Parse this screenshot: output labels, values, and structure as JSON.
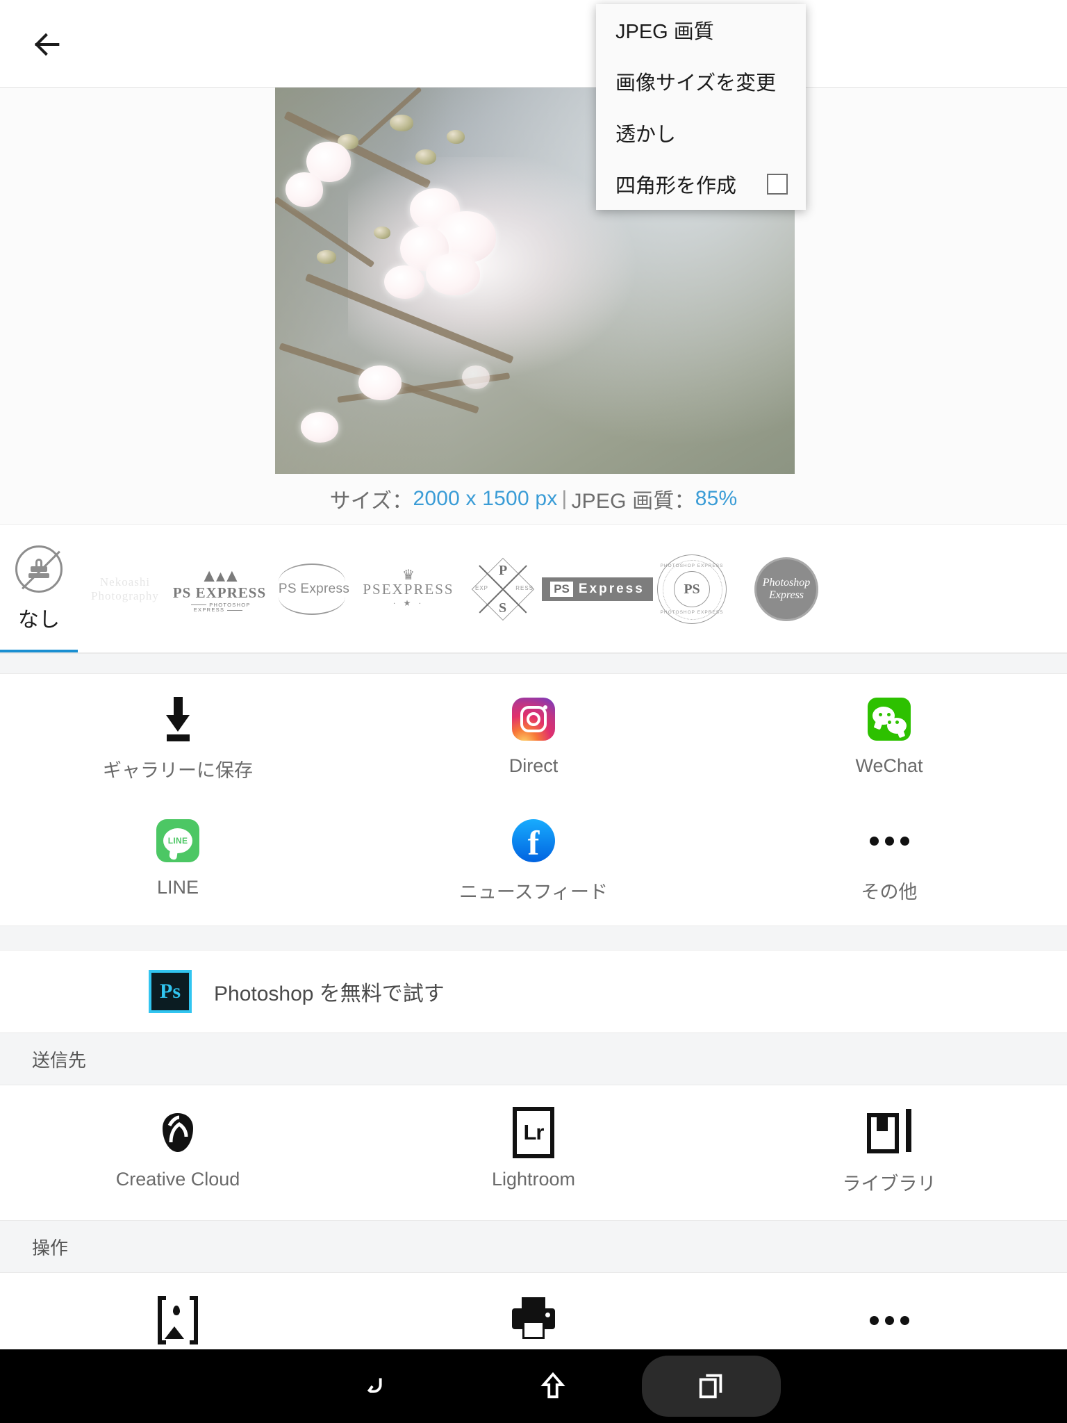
{
  "topbar": {
    "back_icon": "arrow-left-icon"
  },
  "menu": {
    "items": [
      {
        "label": "JPEG 画質",
        "has_checkbox": false
      },
      {
        "label": "画像サイズを変更",
        "has_checkbox": false
      },
      {
        "label": "透かし",
        "has_checkbox": false
      },
      {
        "label": "四角形を作成",
        "has_checkbox": true,
        "checked": false
      }
    ]
  },
  "preview": {
    "size_label": "サイズ：",
    "size_value": "2000 x 1500 px",
    "divider": "|",
    "quality_label": "JPEG 画質：",
    "quality_value": "85%",
    "accent_color": "#3a9cd6"
  },
  "watermarks": {
    "selected_index": 0,
    "items": [
      {
        "name": "なし",
        "type": "none"
      },
      {
        "name": "Nekoashi Photography",
        "type": "faint-text"
      },
      {
        "name": "PS EXPRESS",
        "type": "mountain",
        "sub": "PHOTOSHOP EXPRESS"
      },
      {
        "name": "PS Express",
        "type": "arc"
      },
      {
        "name": "PSEXPRESS",
        "type": "crown"
      },
      {
        "name": "P S EXP RESS",
        "type": "diamond"
      },
      {
        "name": "PS Express",
        "type": "box"
      },
      {
        "name": "PS",
        "type": "seal",
        "top": "PHOTOSHOP EXPRESS",
        "bottom": "PHOTOSHOP EXPRESS"
      },
      {
        "name": "Photoshop Express",
        "type": "badge"
      }
    ]
  },
  "share": {
    "row1": [
      {
        "label": "ギャラリーに保存",
        "icon": "download-icon"
      },
      {
        "label": "Direct",
        "icon": "instagram-icon"
      },
      {
        "label": "WeChat",
        "icon": "wechat-icon"
      }
    ],
    "row2": [
      {
        "label": "LINE",
        "icon": "line-icon"
      },
      {
        "label": "ニュースフィード",
        "icon": "facebook-icon"
      },
      {
        "label": "その他",
        "icon": "more-dots-icon"
      }
    ]
  },
  "promo": {
    "label": "Photoshop を無料で試す",
    "icon": "photoshop-app-icon"
  },
  "sections": {
    "destination": "送信先",
    "actions": "操作"
  },
  "destinations": [
    {
      "label": "Creative Cloud",
      "icon": "creative-cloud-icon"
    },
    {
      "label": "Lightroom",
      "icon": "lightroom-icon"
    },
    {
      "label": "ライブラリ",
      "icon": "library-icon"
    }
  ],
  "actions": [
    {
      "label": "",
      "icon": "photo-frame-icon"
    },
    {
      "label": "",
      "icon": "printer-icon"
    },
    {
      "label": "",
      "icon": "more-dots-icon"
    }
  ],
  "navbar": [
    {
      "icon": "back-nav-icon",
      "name": "back"
    },
    {
      "icon": "home-nav-icon",
      "name": "home"
    },
    {
      "icon": "recents-nav-icon",
      "name": "recents"
    }
  ]
}
